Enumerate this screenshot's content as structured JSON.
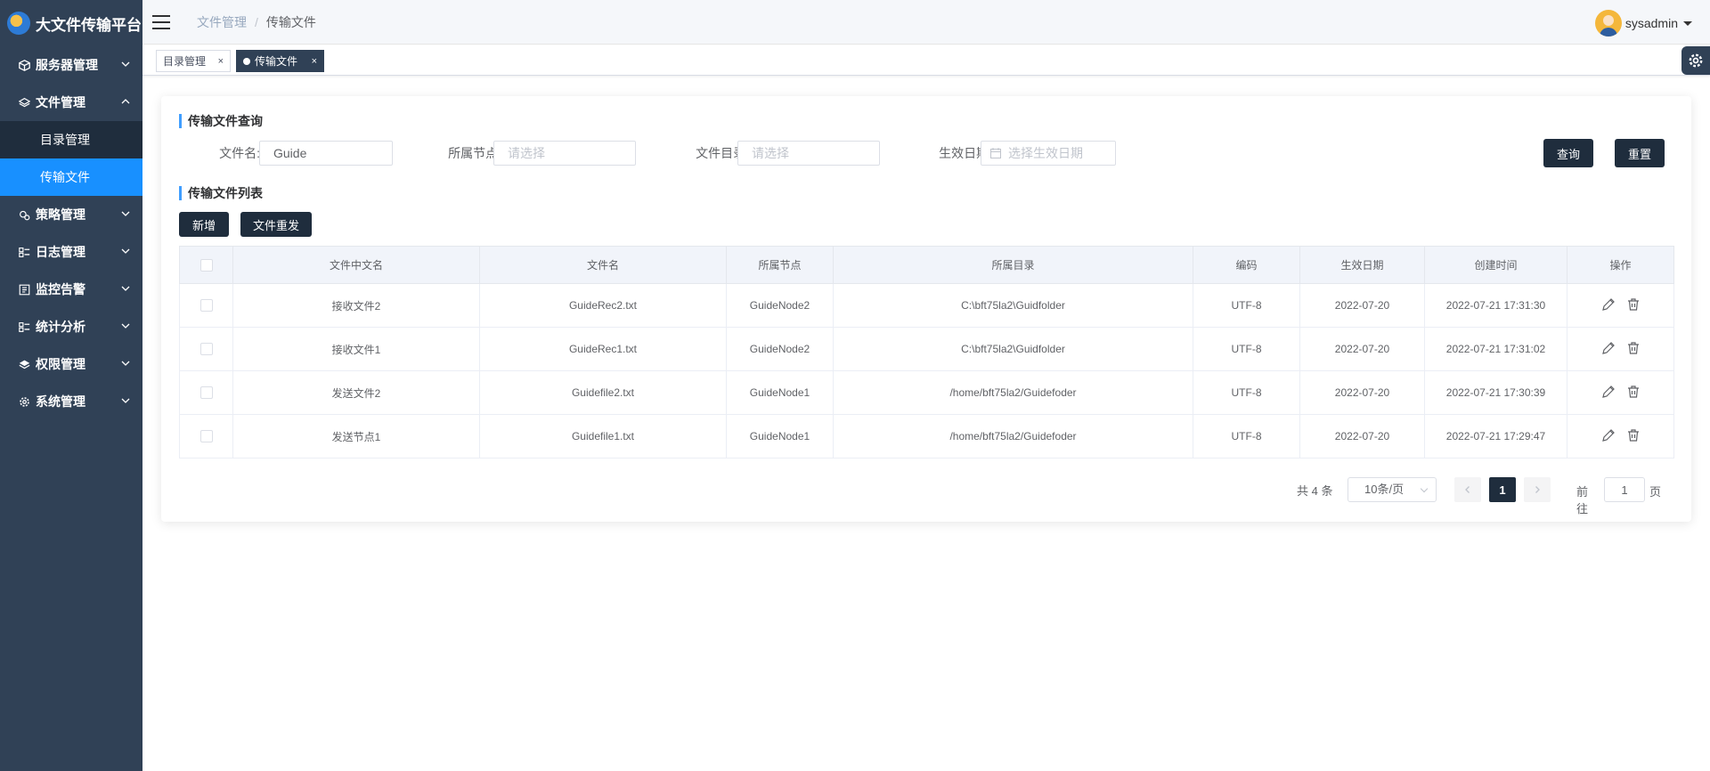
{
  "app": {
    "title": "大文件传输平台"
  },
  "sidebar": {
    "menus": [
      {
        "label": "服务器管理",
        "icon": "cube-icon",
        "expanded": false
      },
      {
        "label": "文件管理",
        "icon": "layers-icon",
        "expanded": true,
        "children": [
          {
            "label": "目录管理",
            "active": false
          },
          {
            "label": "传输文件",
            "active": true
          }
        ]
      },
      {
        "label": "策略管理",
        "icon": "gears-icon",
        "expanded": false
      },
      {
        "label": "日志管理",
        "icon": "list-icon",
        "expanded": false
      },
      {
        "label": "监控告警",
        "icon": "monitor-icon",
        "expanded": false
      },
      {
        "label": "统计分析",
        "icon": "chart-icon",
        "expanded": false
      },
      {
        "label": "权限管理",
        "icon": "shield-icon",
        "expanded": false
      },
      {
        "label": "系统管理",
        "icon": "gear-icon",
        "expanded": false
      }
    ]
  },
  "header": {
    "breadcrumb": [
      "文件管理",
      "传输文件"
    ],
    "user": "sysadmin"
  },
  "tabs": [
    {
      "label": "目录管理",
      "active": false
    },
    {
      "label": "传输文件",
      "active": true
    }
  ],
  "query": {
    "title": "传输文件查询",
    "filename_label": "文件名:",
    "filename_value": "Guide",
    "node_label": "所属节点:",
    "node_placeholder": "请选择",
    "dir_label": "文件目录:",
    "dir_placeholder": "请选择",
    "date_label": "生效日期:",
    "date_placeholder": "选择生效日期",
    "search_btn": "查询",
    "reset_btn": "重置"
  },
  "list": {
    "title": "传输文件列表",
    "add_btn": "新增",
    "resend_btn": "文件重发",
    "columns": [
      "文件中文名",
      "文件名",
      "所属节点",
      "所属目录",
      "编码",
      "生效日期",
      "创建时间",
      "操作"
    ],
    "rows": [
      [
        "接收文件2",
        "GuideRec2.txt",
        "GuideNode2",
        "C:\\bft75la2\\Guidfolder",
        "UTF-8",
        "2022-07-20",
        "2022-07-21 17:31:30"
      ],
      [
        "接收文件1",
        "GuideRec1.txt",
        "GuideNode2",
        "C:\\bft75la2\\Guidfolder",
        "UTF-8",
        "2022-07-20",
        "2022-07-21 17:31:02"
      ],
      [
        "发送文件2",
        "Guidefile2.txt",
        "GuideNode1",
        "/home/bft75la2/Guidefoder",
        "UTF-8",
        "2022-07-20",
        "2022-07-21 17:30:39"
      ],
      [
        "发送节点1",
        "Guidefile1.txt",
        "GuideNode1",
        "/home/bft75la2/Guidefoder",
        "UTF-8",
        "2022-07-20",
        "2022-07-21 17:29:47"
      ]
    ]
  },
  "pagination": {
    "total": "共 4 条",
    "page_size": "10条/页",
    "current": "1",
    "goto_label": "前往",
    "goto_value": "1",
    "page_suffix": "页"
  },
  "colors": {
    "sidebar": "#304156",
    "active": "#1890ff",
    "dark_button": "#1f2d3d",
    "accent": "#409eff"
  }
}
